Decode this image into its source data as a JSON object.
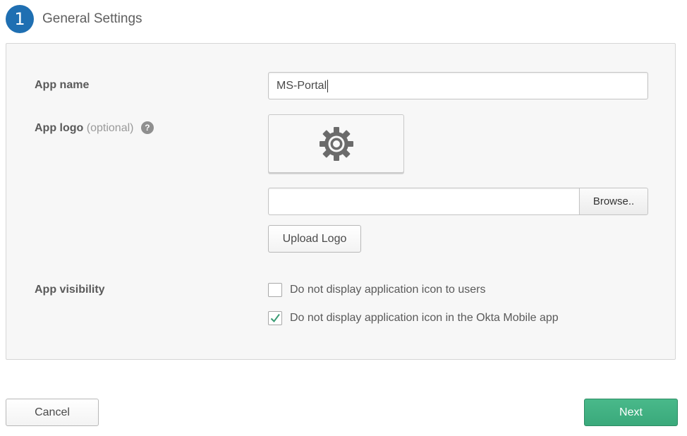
{
  "step": {
    "number": "1",
    "title": "General Settings"
  },
  "form": {
    "app_name": {
      "label": "App name",
      "value": "MS-Portal"
    },
    "app_logo": {
      "label": "App logo",
      "optional": "(optional)",
      "help": "?",
      "placeholder_icon": "gear-icon",
      "browse_label": "Browse..",
      "upload_label": "Upload Logo"
    },
    "app_visibility": {
      "label": "App visibility",
      "options": [
        {
          "label": "Do not display application icon to users",
          "checked": false
        },
        {
          "label": "Do not display application icon in the Okta Mobile app",
          "checked": true
        }
      ]
    }
  },
  "actions": {
    "cancel_label": "Cancel",
    "next_label": "Next"
  },
  "colors": {
    "step_badge": "#1f6fb2",
    "next_button": "#3fae80",
    "check_mark": "#3a9c74"
  }
}
